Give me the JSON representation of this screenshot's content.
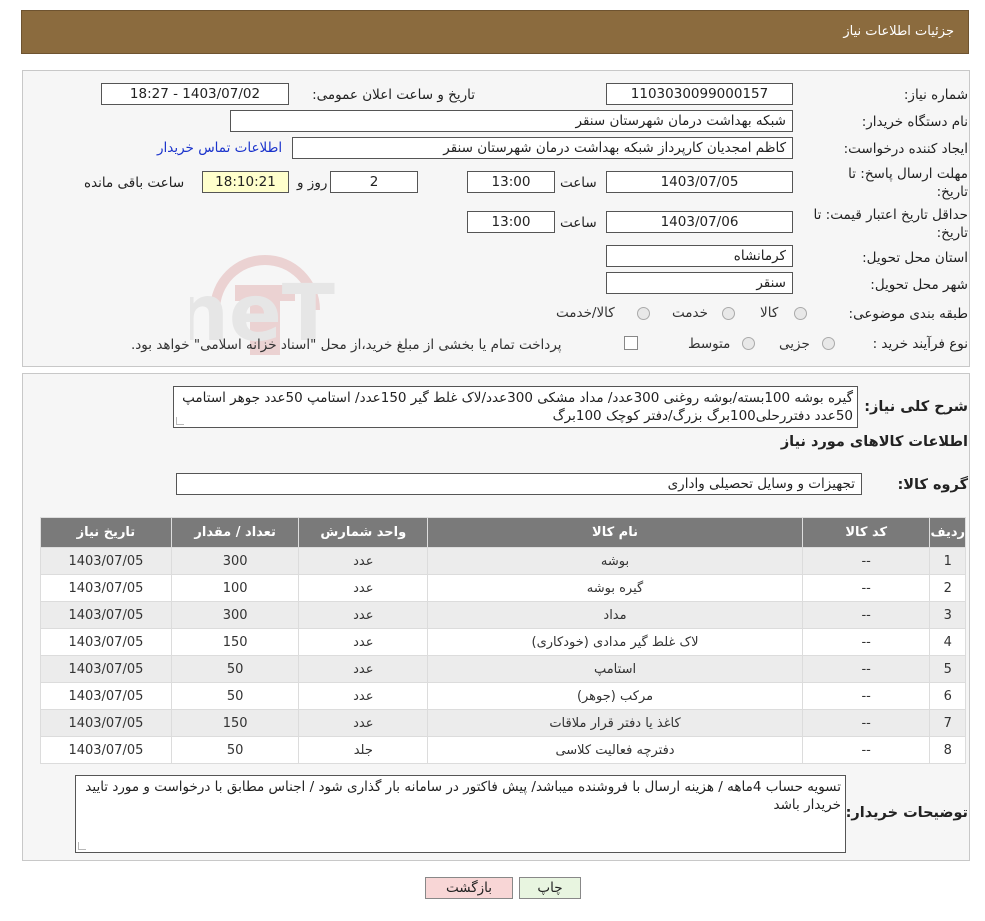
{
  "header": {
    "title": "جزئیات اطلاعات نیاز"
  },
  "form": {
    "need_number": {
      "label": "شماره نیاز:",
      "value": "1103030099000157"
    },
    "announce": {
      "label": "تاریخ و ساعت اعلان عمومی:",
      "value": "1403/07/02 - 18:27"
    },
    "buyer_org": {
      "label": "نام دستگاه خریدار:",
      "value": "شبکه بهداشت درمان شهرستان سنقر"
    },
    "creator": {
      "label": "ایجاد کننده درخواست:",
      "value": "کاظم امجدیان کارپرداز شبکه بهداشت درمان شهرستان سنقر",
      "contact_link": "اطلاعات تماس خریدار"
    },
    "reply_deadline": {
      "label_line1": "مهلت ارسال پاسخ: تا",
      "label_line2": "تاریخ:",
      "date": "1403/07/05",
      "time_label": "ساعت",
      "time": "13:00",
      "days": "2",
      "days_label": "روز و",
      "remaining": "18:10:21",
      "remaining_label": "ساعت باقی مانده"
    },
    "price_validity": {
      "label_line1": "حداقل تاریخ اعتبار قیمت: تا",
      "label_line2": "تاریخ:",
      "date": "1403/07/06",
      "time_label": "ساعت",
      "time": "13:00"
    },
    "province": {
      "label": "استان محل تحویل:",
      "value": "کرمانشاه"
    },
    "city": {
      "label": "شهر محل تحویل:",
      "value": "سنقر"
    },
    "category": {
      "label": "طبقه بندی موضوعی:",
      "options": [
        "کالا",
        "خدمت",
        "کالا/خدمت"
      ]
    },
    "process": {
      "label": "نوع فرآیند خرید :",
      "options": [
        "جزیی",
        "متوسط"
      ],
      "payment_note": "پرداخت تمام یا بخشی از مبلغ خرید،از محل \"اسناد خزانه اسلامی\" خواهد بود."
    }
  },
  "description": {
    "label": "شرح کلی نیاز:",
    "text": "گیره بوشه 100بسته/بوشه روغنی 300عدد/ مداد مشکی 300عدد/لاک غلط گیر 150عدد/ استامپ 50عدد جوهر استامپ 50عدد دفتررحلی100برگ بزرگ/دفتر کوچک 100برگ"
  },
  "goods_section_title": "اطلاعات کالاهای مورد نیاز",
  "goods_group": {
    "label": "گروه کالا:",
    "value": "تجهیزات و وسایل تحصیلی واداری"
  },
  "table": {
    "headers": [
      "ردیف",
      "کد کالا",
      "نام کالا",
      "واحد شمارش",
      "تعداد / مقدار",
      "تاریخ نیاز"
    ],
    "rows": [
      [
        "1",
        "--",
        "بوشه",
        "عدد",
        "300",
        "1403/07/05"
      ],
      [
        "2",
        "--",
        "گیره بوشه",
        "عدد",
        "100",
        "1403/07/05"
      ],
      [
        "3",
        "--",
        "مداد",
        "عدد",
        "300",
        "1403/07/05"
      ],
      [
        "4",
        "--",
        "لاک غلط گیر مدادی (خودکاری)",
        "عدد",
        "150",
        "1403/07/05"
      ],
      [
        "5",
        "--",
        "استامپ",
        "عدد",
        "50",
        "1403/07/05"
      ],
      [
        "6",
        "--",
        "مرکب (جوهر)",
        "عدد",
        "50",
        "1403/07/05"
      ],
      [
        "7",
        "--",
        "کاغذ یا دفتر قرار ملاقات",
        "عدد",
        "150",
        "1403/07/05"
      ],
      [
        "8",
        "--",
        "دفترچه فعالیت کلاسی",
        "جلد",
        "50",
        "1403/07/05"
      ]
    ]
  },
  "buyer_notes": {
    "label": "توضیحات خریدار:",
    "text": "تسویه حساب 4ماهه / هزینه ارسال با فروشنده میباشد/ پیش فاکتور در سامانه بار گذاری شود / اجناس مطابق با درخواست و مورد تایید خریدار باشد"
  },
  "buttons": {
    "print": "چاپ",
    "back": "بازگشت"
  },
  "watermark": {
    "text": "AriaTender.neT"
  }
}
